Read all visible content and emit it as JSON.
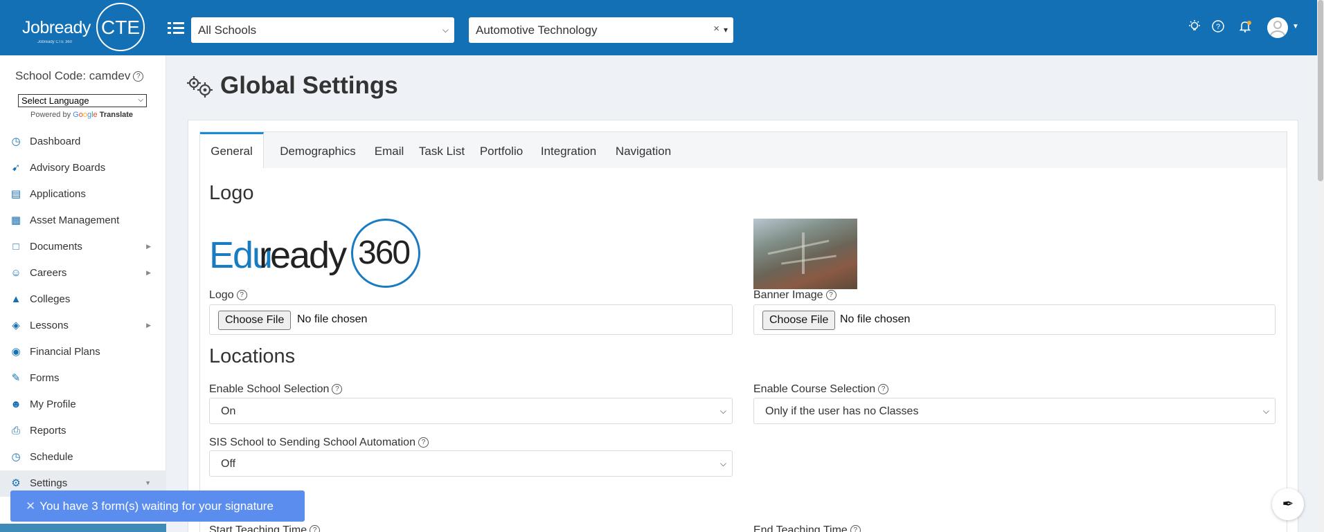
{
  "header": {
    "logo_word": "Jobready",
    "logo_suffix": "CTE",
    "logo_sub": "Jobready CTE 360",
    "school_select": "All Schools",
    "program_select": "Automotive Technology"
  },
  "sidebar": {
    "school_code": "School Code: camdev",
    "language_select": "Select Language",
    "powered_by": "Powered by",
    "translate": "Translate",
    "items": [
      {
        "label": "Dashboard",
        "icon": "dashboard-icon"
      },
      {
        "label": "Advisory Boards",
        "icon": "handshake-icon"
      },
      {
        "label": "Applications",
        "icon": "application-icon"
      },
      {
        "label": "Asset Management",
        "icon": "asset-icon"
      },
      {
        "label": "Documents",
        "icon": "document-icon"
      },
      {
        "label": "Careers",
        "icon": "careers-icon"
      },
      {
        "label": "Colleges",
        "icon": "graduation-cap-icon"
      },
      {
        "label": "Lessons",
        "icon": "lessons-icon"
      },
      {
        "label": "Financial Plans",
        "icon": "piggy-bank-icon"
      },
      {
        "label": "Forms",
        "icon": "forms-icon"
      },
      {
        "label": "My Profile",
        "icon": "user-icon"
      },
      {
        "label": "Reports",
        "icon": "printer-icon"
      },
      {
        "label": "Schedule",
        "icon": "clock-icon"
      },
      {
        "label": "Settings",
        "icon": "gears-icon"
      }
    ]
  },
  "main": {
    "page_title": "Global Settings",
    "tabs": [
      "General",
      "Demographics",
      "Email",
      "Task List",
      "Portfolio",
      "Integration",
      "Navigation"
    ],
    "logo_section": {
      "heading": "Logo",
      "logo_label": "Logo",
      "banner_label": "Banner Image",
      "choose_file": "Choose File",
      "no_file": "No file chosen",
      "edu_logo_a": "Edu",
      "edu_logo_b": "ready",
      "edu_logo_num": "360"
    },
    "locations": {
      "heading": "Locations",
      "enable_school_label": "Enable School Selection",
      "enable_school_value": "On",
      "enable_course_label": "Enable Course Selection",
      "enable_course_value": "Only if the user has no Classes",
      "sis_label": "SIS School to Sending School Automation",
      "sis_value": "Off",
      "start_time_label": "Start Teaching Time",
      "end_time_label": "End Teaching Time"
    }
  },
  "toast": {
    "message": "You have 3 form(s) waiting for your signature"
  },
  "colors": {
    "header_bg": "#1470b4",
    "accent": "#1a8ad6",
    "toast_bg": "#5b8def"
  }
}
